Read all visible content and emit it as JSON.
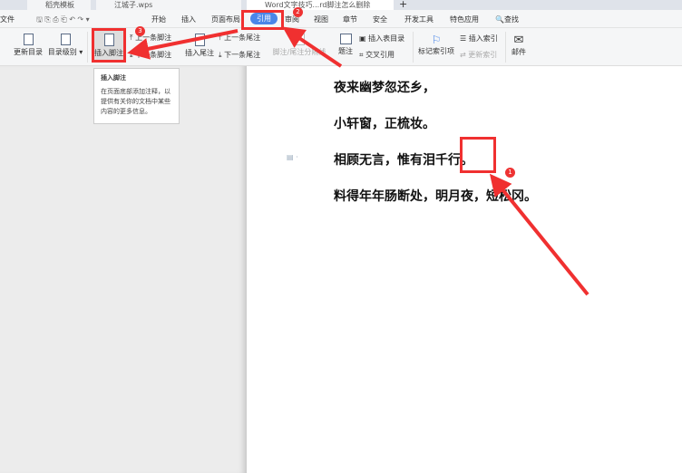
{
  "tabs": [
    {
      "label": "稻壳模板"
    },
    {
      "label": "江城子.wps"
    },
    {
      "label": "Word文字技巧...rd脚注怎么删除"
    }
  ],
  "menu": {
    "file": "文件",
    "items": [
      "开始",
      "插入",
      "页面布局",
      "引用",
      "审阅",
      "视图",
      "章节",
      "安全",
      "开发工具",
      "特色应用"
    ],
    "search": "查找",
    "active": "引用"
  },
  "ribbon": {
    "update_toc": "更新目录",
    "toc_level": "目录级别",
    "insert_footnote": "插入脚注",
    "prev_footnote": "上一条脚注",
    "next_footnote": "下一条脚注",
    "insert_endnote": "插入尾注",
    "prev_endnote": "上一条尾注",
    "next_endnote": "下一条尾注",
    "separator": "脚注/尾注分隔线",
    "caption": "题注",
    "insert_table_toc": "插入表目录",
    "cross_ref": "交叉引用",
    "mark_index": "标记索引项",
    "insert_index": "插入索引",
    "update_index": "更新索引",
    "mail": "邮件"
  },
  "tooltip": {
    "title": "插入脚注",
    "body": "在页面底部添加注释，以提供有关你的文档中某些内容的更多信息。"
  },
  "document": {
    "lines": [
      "夜来幽梦忽还乡，",
      "小轩窗，正梳妆。",
      "相顾无言，惟有泪千行。",
      "料得年年肠断处，明月夜，短松冈。"
    ]
  },
  "annotations": {
    "badges": [
      "1",
      "2",
      "3"
    ],
    "color": "#f03030"
  },
  "colors": {
    "accent": "#4a86e8"
  }
}
